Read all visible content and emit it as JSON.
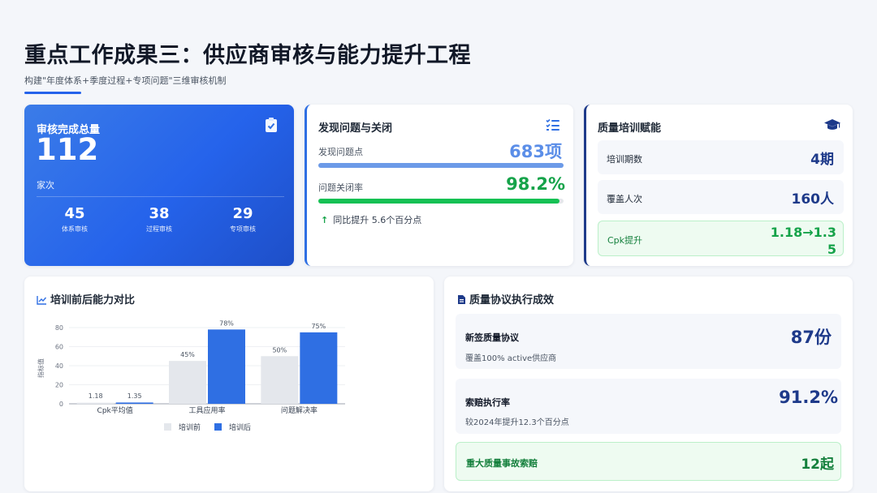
{
  "header": {
    "title": "重点工作成果三：供应商审核与能力提升工程",
    "subtitle": "构建\"年度体系+季度过程+专项问题\"三维审核机制"
  },
  "audit": {
    "label": "审核完成总量",
    "total": "112",
    "unit": "家次",
    "stats": [
      {
        "value": "45",
        "label": "体系审核"
      },
      {
        "value": "38",
        "label": "过程审核"
      },
      {
        "value": "29",
        "label": "专项审核"
      }
    ]
  },
  "issues": {
    "title": "发现问题与关闭",
    "found_label": "发现问题点",
    "found_value": "683项",
    "found_progress": 1.0,
    "close_label": "问题关闭率",
    "close_value": "98.2%",
    "close_progress": 0.982,
    "yoy_arrow": "↑",
    "yoy_text": "同比提升 5.6个百分点"
  },
  "training": {
    "title": "质量培训赋能",
    "rows": [
      {
        "label": "培训期数",
        "value": "4期"
      },
      {
        "label": "覆盖人次",
        "value": "160人"
      },
      {
        "label": "Cpk提升",
        "value": "1.18→1.35"
      }
    ]
  },
  "chart_section": {
    "title": "培训前后能力对比"
  },
  "chart_data": {
    "type": "bar",
    "categories": [
      "Cpk平均值",
      "工具应用率",
      "问题解决率"
    ],
    "series": [
      {
        "name": "培训前",
        "values": [
          1.18,
          45,
          50
        ],
        "labels": [
          "1.18",
          "45%",
          "50%"
        ],
        "color": "#e4e7ec"
      },
      {
        "name": "培训后",
        "values": [
          1.35,
          78,
          75
        ],
        "labels": [
          "1.35",
          "78%",
          "75%"
        ],
        "color": "#2f6fe3"
      }
    ],
    "ylabel": "指标值",
    "ylim": [
      0,
      80
    ],
    "yticks": [
      0,
      20,
      40,
      60,
      80
    ],
    "legend_position": "bottom",
    "grid": true
  },
  "agreement": {
    "title": "质量协议执行成效",
    "rows": [
      {
        "title": "新签质量协议",
        "sub": "覆盖100% active供应商",
        "value": "87份"
      },
      {
        "title": "索赔执行率",
        "sub": "较2024年提升12.3个百分点",
        "value": "91.2%"
      },
      {
        "title": "重大质量事故索赔",
        "value": "12起"
      }
    ]
  },
  "colors": {
    "primary": "#2563eb",
    "navy": "#1e3a8a",
    "green": "#16a34a",
    "light_blue": "#5b8ee8"
  }
}
